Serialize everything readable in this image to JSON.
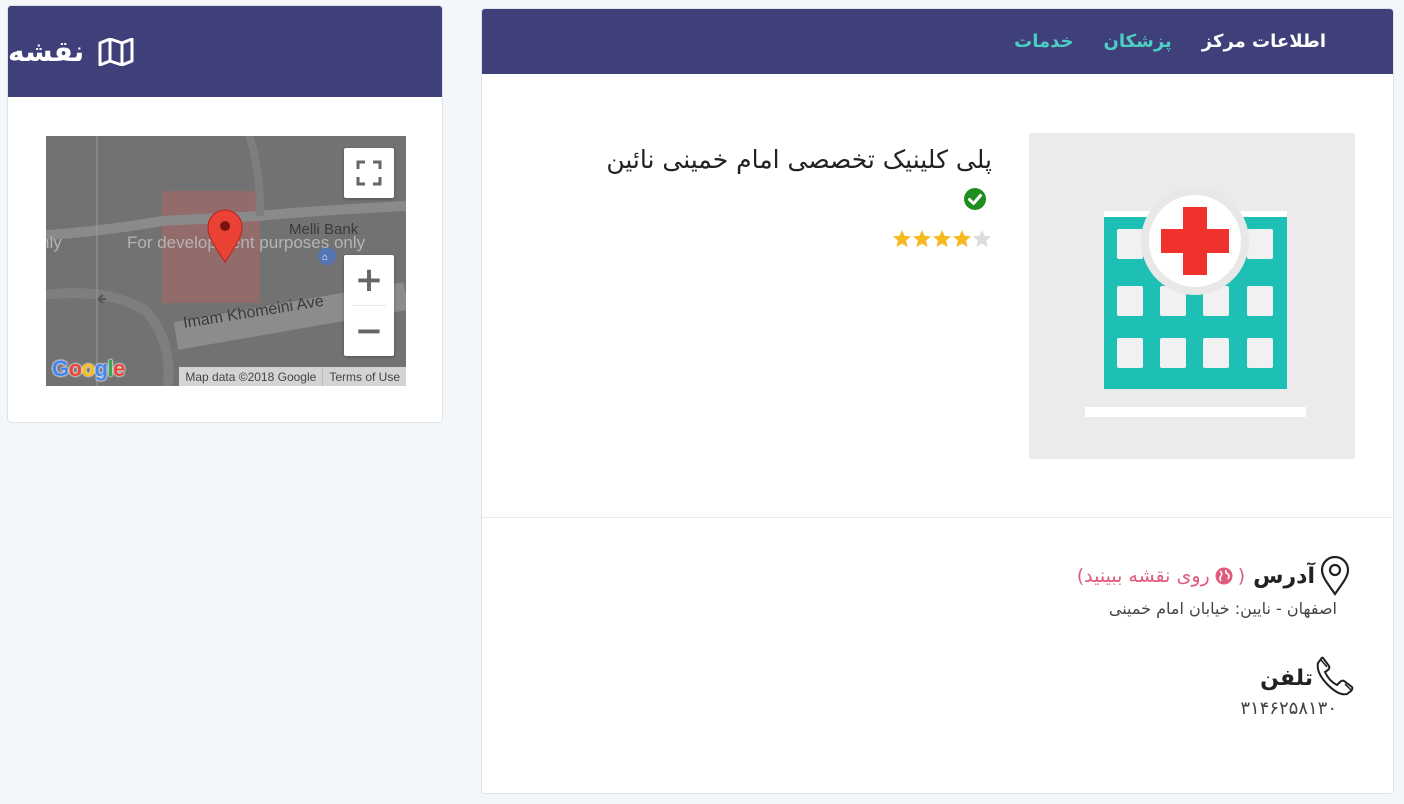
{
  "map_card": {
    "title": "نقشه",
    "icon": "map-icon",
    "map": {
      "street_label": "Imam Khomeini Ave",
      "poi_label": "Melli Bank",
      "watermark": "For development purposes only",
      "watermark_left": "nly",
      "attribution": "Map data ©2018 Google",
      "terms": "Terms of Use",
      "logo": [
        "G",
        "o",
        "o",
        "g",
        "l",
        "e"
      ],
      "logo_colors": [
        "#4285f4",
        "#ea4335",
        "#fbbc05",
        "#4285f4",
        "#34a853",
        "#ea4335"
      ],
      "zoom_in": "+",
      "zoom_out": "−"
    }
  },
  "info_card": {
    "tabs": [
      {
        "label": "اطلاعات مرکز",
        "active": true
      },
      {
        "label": "پزشکان",
        "active": false
      },
      {
        "label": "خدمات",
        "active": false
      }
    ],
    "clinic_name": "پلی کلینیک تخصصی امام خمینی نائین",
    "verified": true,
    "rating": {
      "value": 4,
      "max": 5
    },
    "address": {
      "label": "آدرس",
      "map_link_open": "(",
      "map_link": "روی نقشه ببینید",
      "map_link_close": ")",
      "text": "اصفهان - نایین: خیابان امام خمینی"
    },
    "phone": {
      "label": "تلفن",
      "number": "۳۱۴۶۲۵۸۱۳۰"
    }
  },
  "colors": {
    "header_bg": "#3f3f7a",
    "tab_link": "#4ccfc2",
    "map_link": "#e05a7c",
    "star_filled": "#f5b921",
    "star_empty": "#dcdcdc",
    "verified": "#1e8e1e",
    "hospital_teal": "#1ebfb5",
    "hospital_cross": "#f0322d"
  }
}
